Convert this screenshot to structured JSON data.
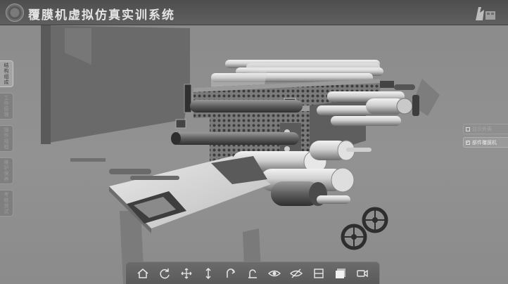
{
  "app": {
    "title": "覆膜机虚拟仿真实训系统"
  },
  "side_nav": {
    "items": [
      {
        "label": "结构组成",
        "active": true
      },
      {
        "label": "工作原理",
        "active": false
      },
      {
        "label": "操作规程",
        "active": false
      },
      {
        "label": "维护保养",
        "active": false
      },
      {
        "label": "考核测试",
        "active": false
      }
    ]
  },
  "right_panel": {
    "items": [
      {
        "label": "显示外壳",
        "checked": false
      },
      {
        "label": "部件覆膜机",
        "checked": true
      }
    ]
  },
  "toolbar": {
    "buttons": [
      {
        "icon": "home-icon"
      },
      {
        "icon": "rotate-icon"
      },
      {
        "icon": "move-icon"
      },
      {
        "icon": "vertical-move-icon"
      },
      {
        "icon": "undo-icon"
      },
      {
        "icon": "reset-icon"
      },
      {
        "icon": "eye-icon"
      },
      {
        "icon": "eye-off-icon"
      },
      {
        "icon": "split-view-icon"
      },
      {
        "icon": "fullscreen-icon"
      },
      {
        "icon": "camera-icon"
      }
    ]
  },
  "colors": {
    "titlebar": "#565656",
    "scene_background": "#8d8d8d",
    "machine_light": "#d8d8d8",
    "machine_dark": "#4a4a4a"
  }
}
